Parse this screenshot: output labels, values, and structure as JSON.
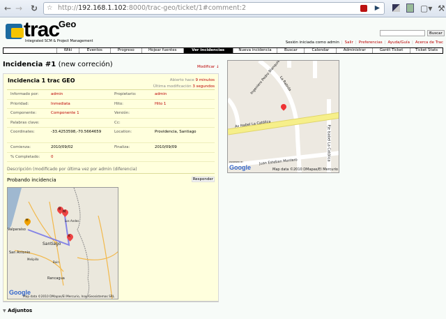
{
  "browser": {
    "url_prefix": "http://",
    "url_host": "192.168.1.102",
    "url_path": ":8000/trac-geo/ticket/1#comment:2"
  },
  "logo": {
    "name": "trac",
    "sup": "Geo",
    "tagline": "Integrated SCM & Project Management"
  },
  "search": {
    "button": "Buscar",
    "value": ""
  },
  "meta": {
    "session": "Sesión iniciada como admin",
    "links": [
      "Salir",
      "Preferencias",
      "Ayuda/Guía",
      "Acerca de Trac"
    ]
  },
  "nav": [
    "Wiki",
    "Eventos",
    "Progreso",
    "Hojear fuentes",
    "Ver incidencias",
    "Nueva incidencia",
    "Buscar",
    "Calendar",
    "Administrar",
    "Gantt Ticket",
    "Ticket Stats"
  ],
  "page": {
    "title": "Incidencia #1",
    "status": "(new correción)",
    "modify": "Modificar ↓"
  },
  "ticket": {
    "summary": "Incidencia 1 trac GEO",
    "opened_label": "Abierto hace",
    "opened": "9 minutos",
    "modified_label": "Última modificación",
    "modified": "3 segundos",
    "fields": [
      [
        "Informado por:",
        "admin",
        "Propietario:",
        "admin"
      ],
      [
        "Prioridad:",
        "Inmediata",
        "Hito:",
        "Hito 1"
      ],
      [
        "Componente:",
        "Componente 1",
        "Versión:",
        ""
      ],
      [
        "Palabras clave:",
        "",
        "Cc:",
        ""
      ],
      [
        "Coordinates:",
        "-33.4253598,-70.5664659",
        "Location:",
        "Providencia, Santiago"
      ],
      [
        "Comienza:",
        "2010/09/02",
        "Finaliza:",
        "2010/09/09"
      ],
      [
        "% Completado:",
        "0",
        "",
        ""
      ]
    ],
    "description_header": "Descripción (modificado por última vez por admin (diferencia)",
    "description": "Probando incidencia",
    "reply": "Responder"
  },
  "map1": {
    "streets": [
      "Av Isabel La Católica",
      "La Rabida",
      "Ingeniero Pedro Blanquier",
      "Pje Isabel La Católica",
      "Juan Esteban Montero"
    ],
    "copyright": "Map data ©2010 DMapas/El Mercurio",
    "powered": "POWERED BY",
    "google": "Google"
  },
  "map2": {
    "places": [
      "Valparaíso",
      "Santiago",
      "San Antonio",
      "Los Andes",
      "Rancagua",
      "Melipilla",
      "Buin"
    ],
    "markers": [
      "H",
      "B",
      "M",
      "K"
    ],
    "copyright": "Map data ©2010 DMapas/El Mercurio, Inav/Geosistemas SRL",
    "google": "Google"
  },
  "attachments": "Adjuntos"
}
